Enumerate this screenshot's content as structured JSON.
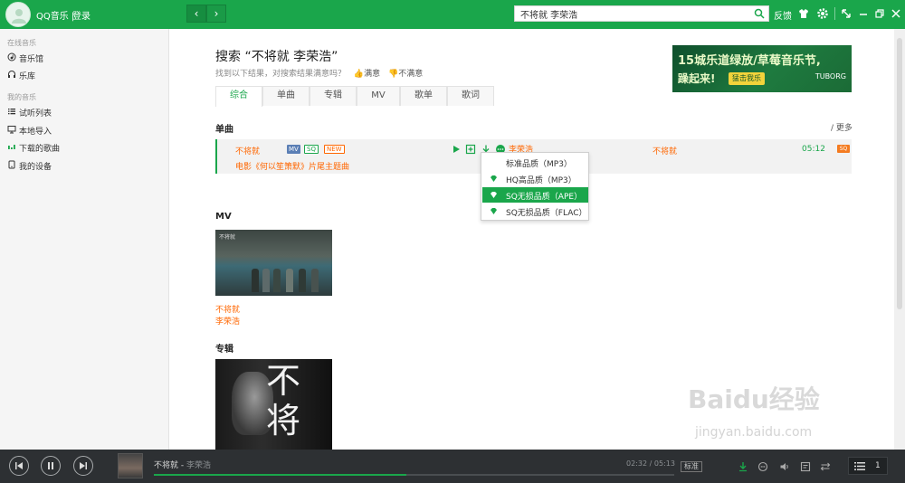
{
  "app": {
    "brand": "QQ音乐 |",
    "login": "登录"
  },
  "header": {
    "search_value": "不将就 李荣浩",
    "feedback": "反馈",
    "accent": "#1aa64b"
  },
  "sidebar": {
    "online_title": "在线音乐",
    "online_items": [
      {
        "label": "音乐馆",
        "icon": "music-hall-icon"
      },
      {
        "label": "乐库",
        "icon": "headphones-icon"
      }
    ],
    "mine_title": "我的音乐",
    "mine_items": [
      {
        "label": "试听列表",
        "icon": "list-icon"
      },
      {
        "label": "本地导入",
        "icon": "monitor-icon"
      },
      {
        "label": "下载的歌曲",
        "icon": "download-bars-icon"
      },
      {
        "label": "我的设备",
        "icon": "device-icon"
      }
    ]
  },
  "search_result": {
    "title": "搜索 “不将就 李荣浩”",
    "subtitle": "找到以下结果，对搜索结果满意吗？",
    "satisfied": "满意",
    "unsatisfied": "不满意"
  },
  "banner": {
    "line1": "15城乐道绿放/草莓音乐节,",
    "line2": "躁起来!",
    "cta": "猛击我乐",
    "sponsor": "TUBORG"
  },
  "tabs": [
    "综合",
    "单曲",
    "专辑",
    "MV",
    "歌单",
    "歌词"
  ],
  "songs_section": {
    "title": "单曲",
    "more": "/ 更多"
  },
  "song": {
    "name": "不将就",
    "badges": [
      "MV",
      "SQ",
      "NEW"
    ],
    "desc": "电影《何以笙箫默》片尾主题曲",
    "artist": "李荣浩",
    "album": "不将就",
    "duration": "05:12",
    "quality_badge": "SQ"
  },
  "quality_menu": {
    "items": [
      "标准品质（MP3）",
      "HQ高品质（MP3）",
      "SQ无损品质（APE）",
      "SQ无损品质（FLAC）"
    ],
    "selected_index": 2
  },
  "mv_section": {
    "title": "MV",
    "name": "不将就",
    "artist": "李荣浩"
  },
  "album_section": {
    "title": "专辑",
    "cover_text": "不将"
  },
  "player": {
    "title": "不将就",
    "separator": " - ",
    "artist": "李荣浩",
    "current": "02:32",
    "total": "/ 05:13",
    "progress": 0.486,
    "quality": "标准",
    "playlist_count": "1"
  },
  "watermark": {
    "line1": "Baidu经验",
    "line2": "jingyan.baidu.com"
  }
}
